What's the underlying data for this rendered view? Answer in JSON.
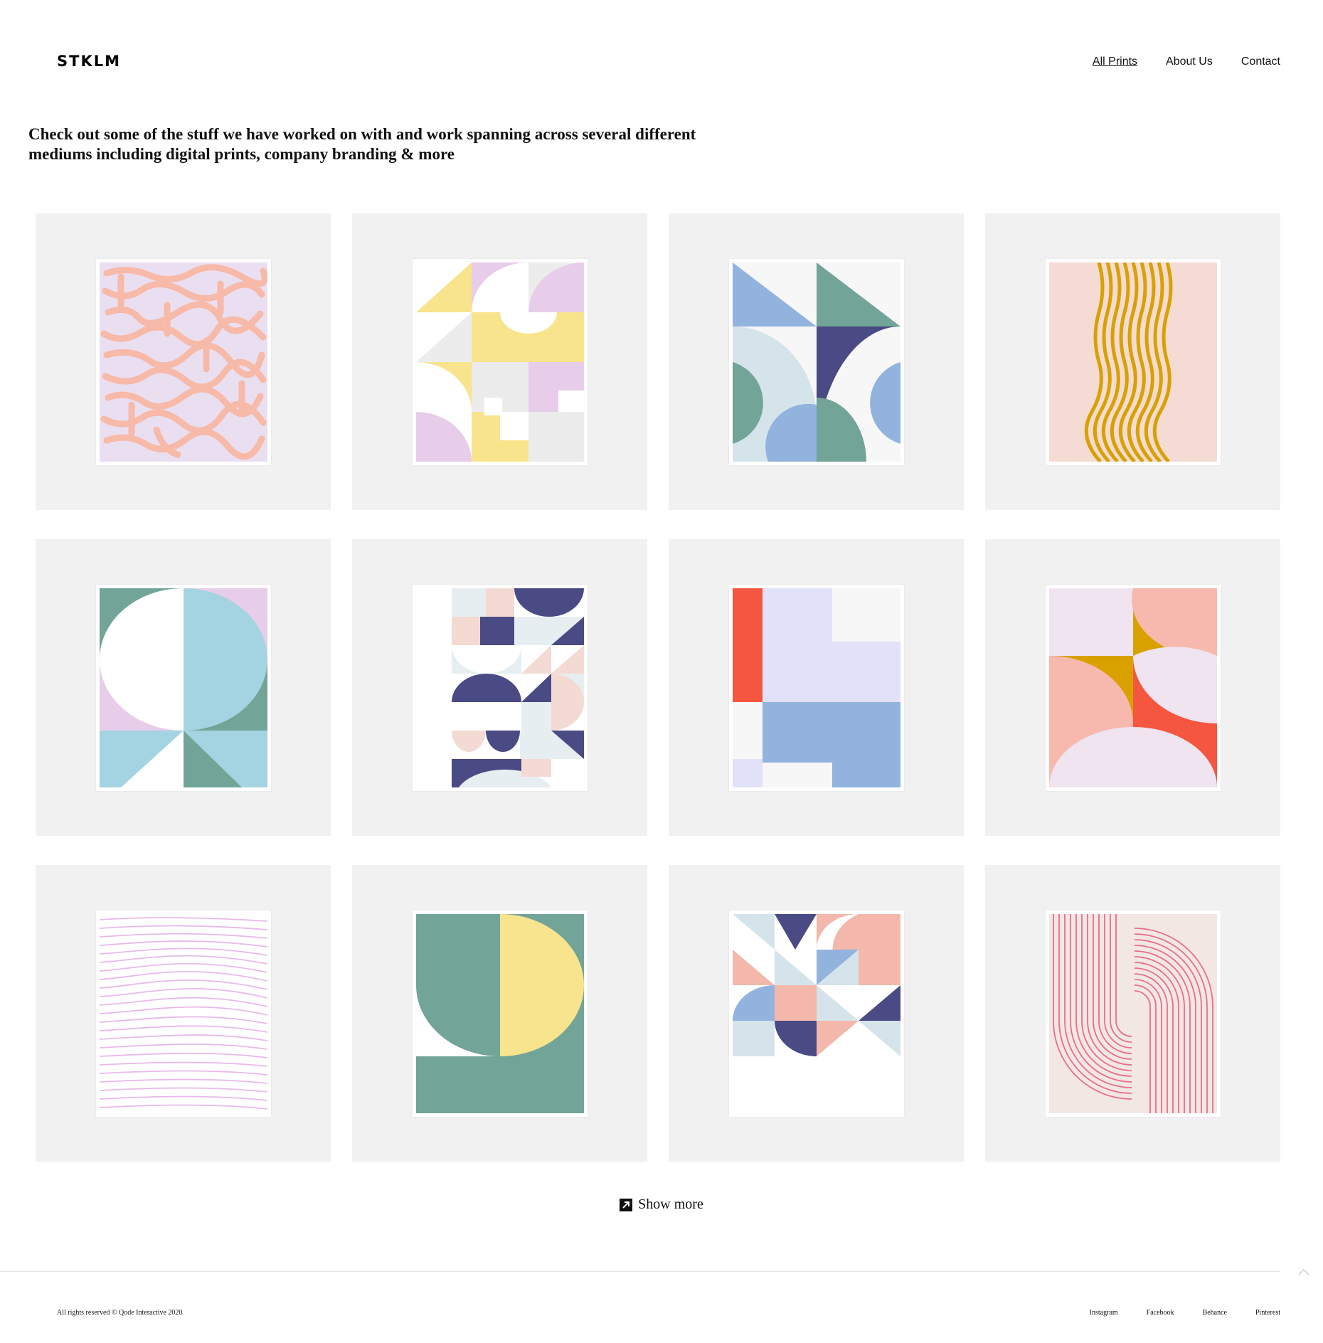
{
  "header": {
    "logo": "STKLM",
    "nav": [
      {
        "label": "All Prints",
        "active": true
      },
      {
        "label": "About Us",
        "active": false
      },
      {
        "label": "Contact",
        "active": false
      }
    ]
  },
  "intro": {
    "line1": "Check out some of the stuff we have worked on with and work spanning across several different",
    "line2": "mediums including digital prints, company branding & more"
  },
  "prints": [
    {
      "name": "pink-maze-pattern-print",
      "colors": [
        "#f7b9a8",
        "#eadff0"
      ]
    },
    {
      "name": "yellow-lilac-geometric-print",
      "colors": [
        "#f7e48c",
        "#e8cdea",
        "#ececec"
      ]
    },
    {
      "name": "blue-green-arches-print",
      "colors": [
        "#92b3dd",
        "#72a497",
        "#4a4a85",
        "#d4e4ea"
      ]
    },
    {
      "name": "gold-wavy-lines-print",
      "colors": [
        "#d9a100",
        "#f4dcd4"
      ]
    },
    {
      "name": "teal-circle-quadrants-print",
      "colors": [
        "#a4d3e1",
        "#72a497",
        "#e8cdea"
      ]
    },
    {
      "name": "navy-blush-mosaic-print",
      "colors": [
        "#4a4a85",
        "#f3dad3",
        "#e7eef1"
      ]
    },
    {
      "name": "red-lavender-blocks-print",
      "colors": [
        "#f5563f",
        "#e2e1fa",
        "#92b3dd"
      ]
    },
    {
      "name": "salmon-mustard-curves-print",
      "colors": [
        "#f7b9ae",
        "#f5563f",
        "#d9a100",
        "#efe4ef"
      ]
    },
    {
      "name": "lilac-line-wave-print",
      "colors": [
        "#e8b9ea",
        "#ffffff"
      ]
    },
    {
      "name": "green-yellow-arch-print",
      "colors": [
        "#72a497",
        "#f7e48c"
      ]
    },
    {
      "name": "pastel-triangle-grid-print",
      "colors": [
        "#4a4a85",
        "#f3b7ac",
        "#d4e4ea",
        "#92b3dd"
      ]
    },
    {
      "name": "pink-concentric-lines-print",
      "colors": [
        "#e86d8e",
        "#f3e7e4"
      ]
    }
  ],
  "show_more": {
    "label": "Show more",
    "icon": "arrow-up-right-icon"
  },
  "footer": {
    "copyright": "All rights reserved © Qode Interactive 2020",
    "social": [
      "Instagram",
      "Facebook",
      "Behance",
      "Pinterest"
    ]
  }
}
